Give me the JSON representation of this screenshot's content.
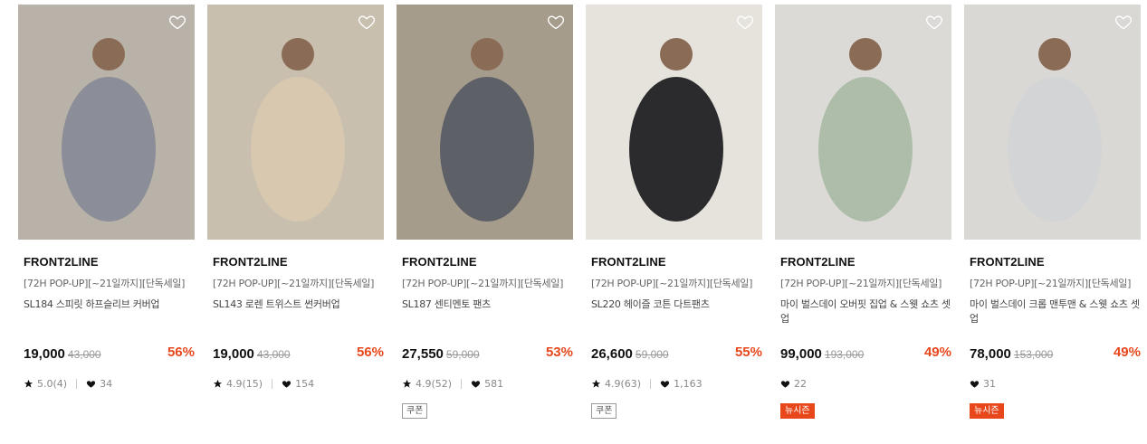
{
  "products": [
    {
      "brand": "FRONT2LINE",
      "promo": "[72H POP-UP][~21일까지][단독세일]",
      "name": "SL184 스피릿 하프슬리브 커버업",
      "price": "19,000",
      "original_price": "43,000",
      "discount": "56%",
      "rating": "5.0(4)",
      "likes": "34",
      "badge": "",
      "photo_bg": "#b9b2a8",
      "photo_fg": "#8b8e98"
    },
    {
      "brand": "FRONT2LINE",
      "promo": "[72H POP-UP][~21일까지][단독세일]",
      "name": "SL143 로렌 트위스트 썬커버업",
      "price": "19,000",
      "original_price": "43,000",
      "discount": "56%",
      "rating": "4.9(15)",
      "likes": "154",
      "badge": "",
      "photo_bg": "#c8bfae",
      "photo_fg": "#d9c8b0"
    },
    {
      "brand": "FRONT2LINE",
      "promo": "[72H POP-UP][~21일까지][단독세일]",
      "name": "SL187 센티멘토 팬츠",
      "price": "27,550",
      "original_price": "59,000",
      "discount": "53%",
      "rating": "4.9(52)",
      "likes": "581",
      "badge": "쿠폰",
      "badge_type": "coupon",
      "photo_bg": "#a69c8c",
      "photo_fg": "#5e6068"
    },
    {
      "brand": "FRONT2LINE",
      "promo": "[72H POP-UP][~21일까지][단독세일]",
      "name": "SL220 헤이즐 코튼 다트팬츠",
      "price": "26,600",
      "original_price": "59,000",
      "discount": "55%",
      "rating": "4.9(63)",
      "likes": "1,163",
      "badge": "쿠폰",
      "badge_type": "coupon",
      "photo_bg": "#e6e2dc",
      "photo_fg": "#2b2b2e"
    },
    {
      "brand": "FRONT2LINE",
      "promo": "[72H POP-UP][~21일까지][단독세일]",
      "name": "마이 벌스데이 오버핏 집업 & 스웻 쇼츠 셋업",
      "price": "99,000",
      "original_price": "193,000",
      "discount": "49%",
      "rating": "",
      "likes": "22",
      "badge": "뉴시즌",
      "badge_type": "new",
      "photo_bg": "#dcdad6",
      "photo_fg": "#aebdaa"
    },
    {
      "brand": "FRONT2LINE",
      "promo": "[72H POP-UP][~21일까지][단독세일]",
      "name": "마이 벌스데이 크롭 맨투맨 & 스웻 쇼츠 셋업",
      "price": "78,000",
      "original_price": "153,000",
      "discount": "49%",
      "rating": "",
      "likes": "31",
      "badge": "뉴시즌",
      "badge_type": "new",
      "photo_bg": "#dad8d4",
      "photo_fg": "#d3d4d6"
    }
  ],
  "icons": {
    "wishlist": "heart-outline-icon",
    "star": "star-icon",
    "like": "heart-filled-icon"
  },
  "colors": {
    "discount": "#e8471c",
    "new_badge": "#e8471c"
  }
}
